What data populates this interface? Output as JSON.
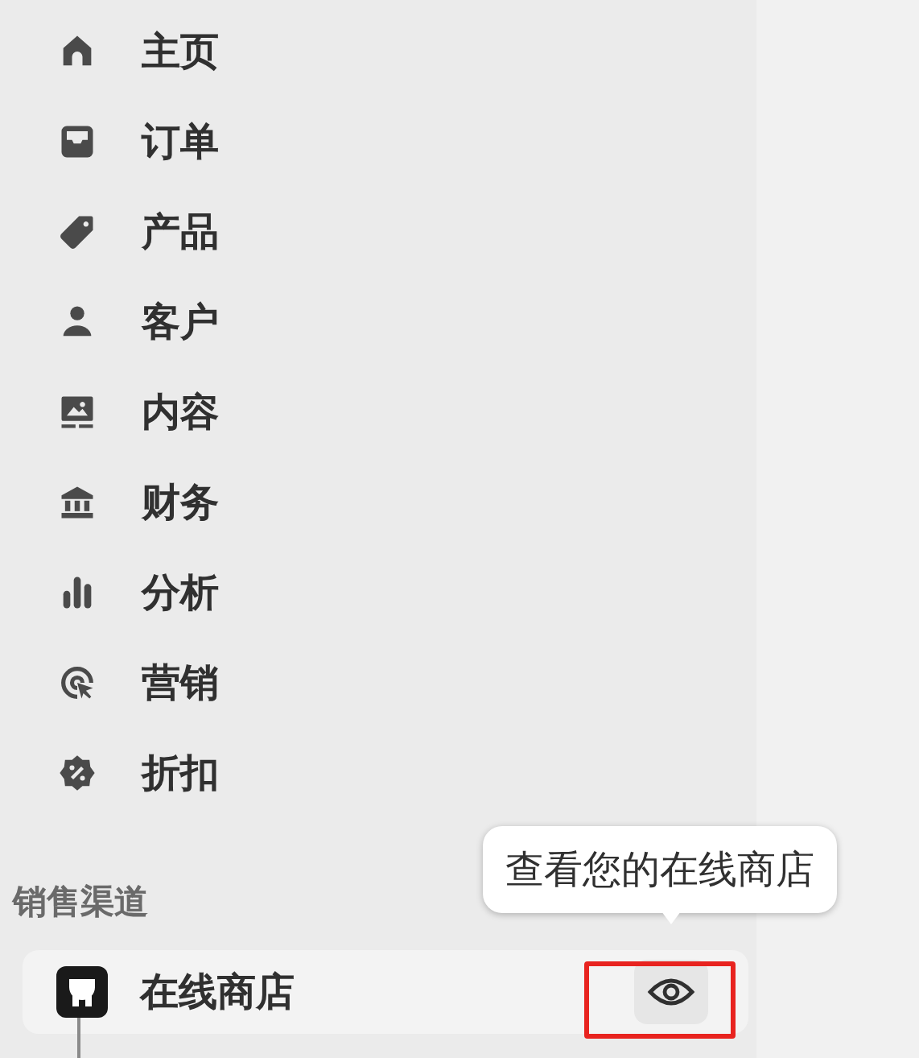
{
  "nav": [
    {
      "label": "主页",
      "kind": "home"
    },
    {
      "label": "订单",
      "kind": "inbox"
    },
    {
      "label": "产品",
      "kind": "tag"
    },
    {
      "label": "客户",
      "kind": "person"
    },
    {
      "label": "内容",
      "kind": "image"
    },
    {
      "label": "财务",
      "kind": "bank"
    },
    {
      "label": "分析",
      "kind": "bars"
    },
    {
      "label": "营销",
      "kind": "target"
    },
    {
      "label": "折扣",
      "kind": "badge"
    }
  ],
  "sales_channels": {
    "heading": "销售渠道",
    "items": [
      {
        "label": "在线商店",
        "tooltip": "查看您的在线商店"
      }
    ]
  }
}
